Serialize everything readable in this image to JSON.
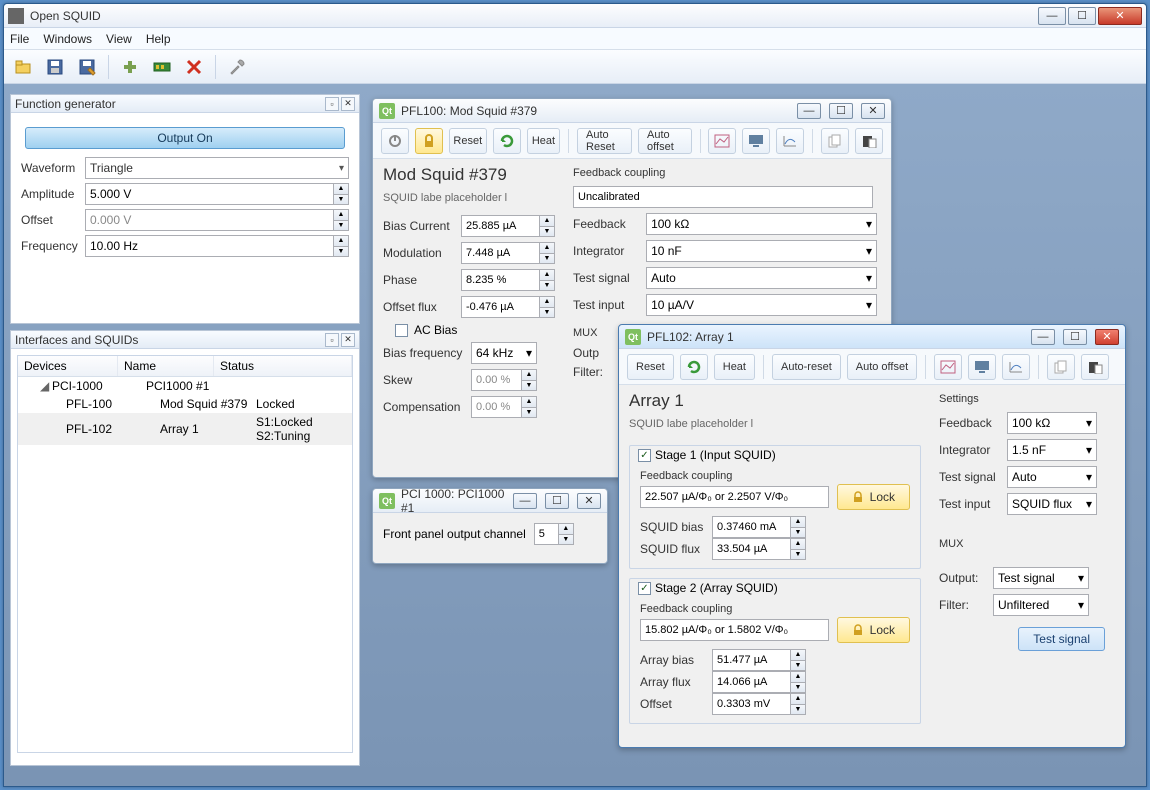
{
  "window": {
    "title": "Open SQUID"
  },
  "menu": {
    "file": "File",
    "windows": "Windows",
    "view": "View",
    "help": "Help"
  },
  "funcgen": {
    "title": "Function generator",
    "output_btn": "Output On",
    "waveform_label": "Waveform",
    "waveform_value": "Triangle",
    "amplitude_label": "Amplitude",
    "amplitude_value": "5.000 V",
    "offset_label": "Offset",
    "offset_value": "0.000 V",
    "frequency_label": "Frequency",
    "frequency_value": "10.00 Hz"
  },
  "interfaces": {
    "title": "Interfaces and SQUIDs",
    "cols": {
      "devices": "Devices",
      "name": "Name",
      "status": "Status"
    },
    "rows": [
      {
        "dev": "PCI-1000",
        "name": "PCI1000 #1",
        "status": ""
      },
      {
        "dev": "PFL-100",
        "name": "Mod Squid #379",
        "status": "Locked"
      },
      {
        "dev": "PFL-102",
        "name": "Array 1",
        "status": "S1:Locked  S2:Tuning"
      }
    ]
  },
  "pfl100": {
    "wintitle": "PFL100: Mod Squid #379",
    "tb": {
      "reset": "Reset",
      "heat": "Heat",
      "auto_reset": "Auto Reset",
      "auto_offset": "Auto offset"
    },
    "title": "Mod Squid #379",
    "subtitle": "SQUID labe placeholder l",
    "bias_current_l": "Bias Current",
    "bias_current_v": "25.885 µA",
    "modulation_l": "Modulation",
    "modulation_v": "7.448 µA",
    "phase_l": "Phase",
    "phase_v": "8.235 %",
    "offset_flux_l": "Offset flux",
    "offset_flux_v": "-0.476 µA",
    "ac_bias_l": "AC Bias",
    "bias_freq_l": "Bias frequency",
    "bias_freq_v": "64 kHz",
    "skew_l": "Skew",
    "skew_v": "0.00 %",
    "comp_l": "Compensation",
    "comp_v": "0.00 %",
    "fb_coupling_l": "Feedback coupling",
    "fb_coupling_v": "Uncalibrated",
    "feedback_l": "Feedback",
    "feedback_v": "100 kΩ",
    "integrator_l": "Integrator",
    "integrator_v": "10 nF",
    "testsig_l": "Test signal",
    "testsig_v": "Auto",
    "testin_l": "Test input",
    "testin_v": "10 µA/V",
    "mux_l": "MUX",
    "output_l": "Outp",
    "filter_l": "Filter:"
  },
  "pci1000": {
    "wintitle": "PCI 1000: PCI1000 #1",
    "channel_l": "Front panel output channel",
    "channel_v": "5"
  },
  "pfl102": {
    "wintitle": "PFL102: Array 1",
    "tb": {
      "reset": "Reset",
      "heat": "Heat",
      "auto_reset": "Auto-reset",
      "auto_offset": "Auto offset"
    },
    "title": "Array 1",
    "subtitle": "SQUID labe placeholder l",
    "stage1_l": "Stage 1 (Input SQUID)",
    "s1_fbcoup_l": "Feedback coupling",
    "s1_fbcoup_v": "22.507 µA/Φ₀ or 2.2507 V/Φ₀",
    "s1_lock": "Lock",
    "s1_bias_l": "SQUID bias",
    "s1_bias_v": "0.37460 mA",
    "s1_flux_l": "SQUID flux",
    "s1_flux_v": "33.504 µA",
    "stage2_l": "Stage 2 (Array SQUID)",
    "s2_fbcoup_l": "Feedback coupling",
    "s2_fbcoup_v": "15.802 µA/Φ₀ or 1.5802 V/Φ₀",
    "s2_lock": "Lock",
    "s2_abias_l": "Array bias",
    "s2_abias_v": "51.477 µA",
    "s2_aflux_l": "Array flux",
    "s2_aflux_v": "14.066 µA",
    "s2_offset_l": "Offset",
    "s2_offset_v": "0.3303 mV",
    "settings_l": "Settings",
    "feedback_l": "Feedback",
    "feedback_v": "100 kΩ",
    "integrator_l": "Integrator",
    "integrator_v": "1.5 nF",
    "testsig_l": "Test signal",
    "testsig_v": "Auto",
    "testin_l": "Test input",
    "testin_v": "SQUID flux",
    "mux_l": "MUX",
    "output_l": "Output:",
    "output_v": "Test signal",
    "filter_l": "Filter:",
    "filter_v": "Unfiltered",
    "testsig_btn": "Test signal"
  }
}
